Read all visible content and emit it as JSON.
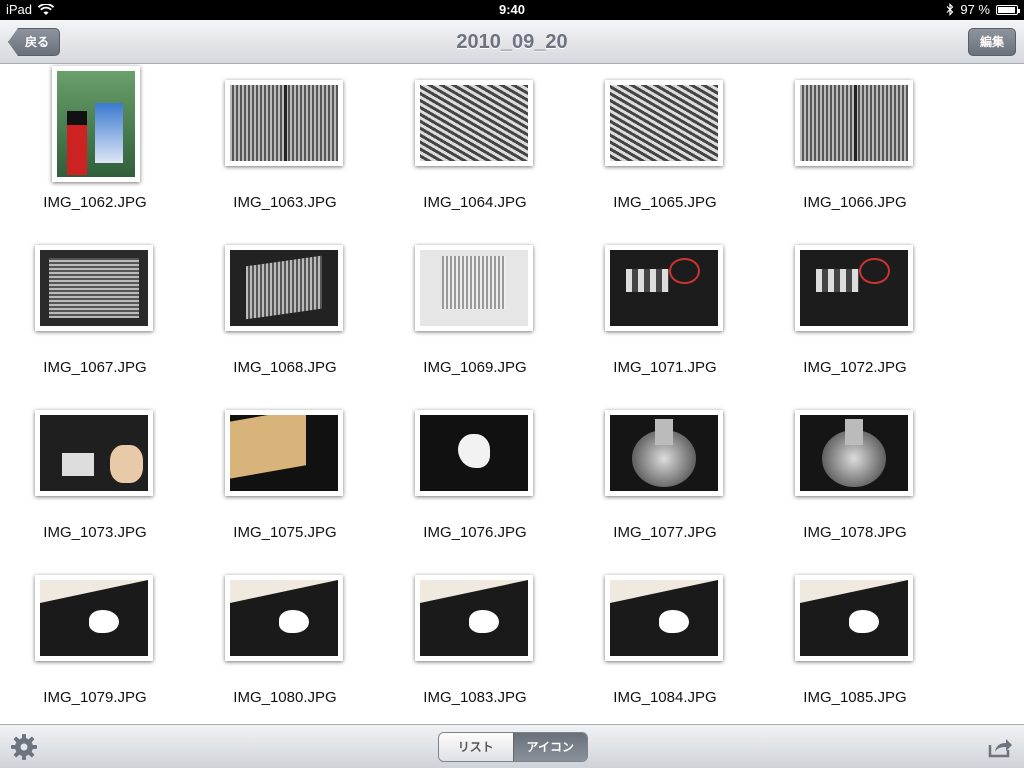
{
  "status_bar": {
    "device": "iPad",
    "time": "9:40",
    "battery_text": "97 %",
    "battery_level": 0.97,
    "wifi_icon": "wifi-icon",
    "bluetooth_icon": "bluetooth-icon"
  },
  "nav": {
    "back_label": "戻る",
    "title": "2010_09_20",
    "edit_label": "編集"
  },
  "photos": [
    {
      "name": "IMG_1062.JPG",
      "style": "bottles",
      "orientation": "portrait"
    },
    {
      "name": "IMG_1063.JPG",
      "style": "filter2",
      "orientation": "landscape"
    },
    {
      "name": "IMG_1064.JPG",
      "style": "diag",
      "orientation": "landscape"
    },
    {
      "name": "IMG_1065.JPG",
      "style": "diag",
      "orientation": "landscape"
    },
    {
      "name": "IMG_1066.JPG",
      "style": "filter2",
      "orientation": "landscape"
    },
    {
      "name": "IMG_1067.JPG",
      "style": "filter1",
      "orientation": "landscape"
    },
    {
      "name": "IMG_1068.JPG",
      "style": "filter-tilt",
      "orientation": "landscape"
    },
    {
      "name": "IMG_1069.JPG",
      "style": "filter-light",
      "orientation": "landscape"
    },
    {
      "name": "IMG_1071.JPG",
      "style": "engine",
      "orientation": "landscape"
    },
    {
      "name": "IMG_1072.JPG",
      "style": "engine",
      "orientation": "landscape"
    },
    {
      "name": "IMG_1073.JPG",
      "style": "hand",
      "orientation": "landscape"
    },
    {
      "name": "IMG_1075.JPG",
      "style": "tan",
      "orientation": "landscape"
    },
    {
      "name": "IMG_1076.JPG",
      "style": "blob",
      "orientation": "landscape"
    },
    {
      "name": "IMG_1077.JPG",
      "style": "can",
      "orientation": "landscape"
    },
    {
      "name": "IMG_1078.JPG",
      "style": "can",
      "orientation": "landscape"
    },
    {
      "name": "IMG_1079.JPG",
      "style": "spill",
      "orientation": "landscape"
    },
    {
      "name": "IMG_1080.JPG",
      "style": "spill",
      "orientation": "landscape"
    },
    {
      "name": "IMG_1083.JPG",
      "style": "spill",
      "orientation": "landscape"
    },
    {
      "name": "IMG_1084.JPG",
      "style": "spill",
      "orientation": "landscape"
    },
    {
      "name": "IMG_1085.JPG",
      "style": "spill",
      "orientation": "landscape"
    }
  ],
  "toolbar": {
    "settings_icon": "gear-icon",
    "share_icon": "share-icon",
    "segments": [
      {
        "label": "リスト",
        "selected": false
      },
      {
        "label": "アイコン",
        "selected": true
      }
    ]
  }
}
